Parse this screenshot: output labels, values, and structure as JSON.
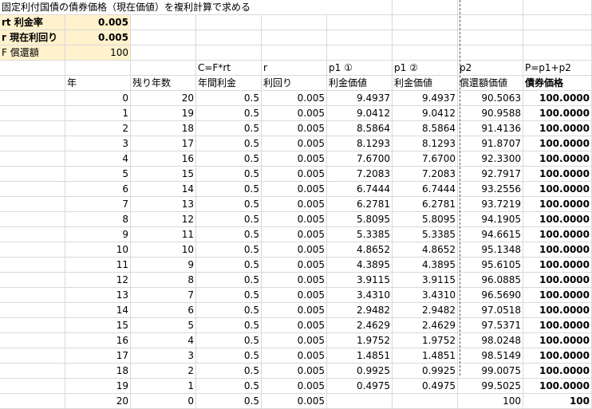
{
  "sheet": {
    "title": "固定利付国債の債券価格（現在価値）を複利計算で求める",
    "params": [
      {
        "label": "rt 利金率",
        "value": "0.005",
        "bold": true
      },
      {
        "label": "r 現在利回り",
        "value": "0.005",
        "bold": true
      },
      {
        "label": "F 償還額",
        "value": "100",
        "bold": false
      }
    ],
    "header_row1": [
      "",
      "",
      "",
      "C=F*rt",
      "r",
      "p1 ①",
      "p1 ②",
      "p2",
      "P=p1+p2"
    ],
    "header_row2": [
      "",
      "年",
      "残り年数",
      "年間利金",
      "利回り",
      "利金価値",
      "利金価値",
      "償還額価値",
      "債券価格"
    ],
    "rows": [
      [
        "0",
        "20",
        "0.5",
        "0.005",
        "9.4937",
        "9.4937",
        "90.5063",
        "100.0000"
      ],
      [
        "1",
        "19",
        "0.5",
        "0.005",
        "9.0412",
        "9.0412",
        "90.9588",
        "100.0000"
      ],
      [
        "2",
        "18",
        "0.5",
        "0.005",
        "8.5864",
        "8.5864",
        "91.4136",
        "100.0000"
      ],
      [
        "3",
        "17",
        "0.5",
        "0.005",
        "8.1293",
        "8.1293",
        "91.8707",
        "100.0000"
      ],
      [
        "4",
        "16",
        "0.5",
        "0.005",
        "7.6700",
        "7.6700",
        "92.3300",
        "100.0000"
      ],
      [
        "5",
        "15",
        "0.5",
        "0.005",
        "7.2083",
        "7.2083",
        "92.7917",
        "100.0000"
      ],
      [
        "6",
        "14",
        "0.5",
        "0.005",
        "6.7444",
        "6.7444",
        "93.2556",
        "100.0000"
      ],
      [
        "7",
        "13",
        "0.5",
        "0.005",
        "6.2781",
        "6.2781",
        "93.7219",
        "100.0000"
      ],
      [
        "8",
        "12",
        "0.5",
        "0.005",
        "5.8095",
        "5.8095",
        "94.1905",
        "100.0000"
      ],
      [
        "9",
        "11",
        "0.5",
        "0.005",
        "5.3385",
        "5.3385",
        "94.6615",
        "100.0000"
      ],
      [
        "10",
        "10",
        "0.5",
        "0.005",
        "4.8652",
        "4.8652",
        "95.1348",
        "100.0000"
      ],
      [
        "11",
        "9",
        "0.5",
        "0.005",
        "4.3895",
        "4.3895",
        "95.6105",
        "100.0000"
      ],
      [
        "12",
        "8",
        "0.5",
        "0.005",
        "3.9115",
        "3.9115",
        "96.0885",
        "100.0000"
      ],
      [
        "13",
        "7",
        "0.5",
        "0.005",
        "3.4310",
        "3.4310",
        "96.5690",
        "100.0000"
      ],
      [
        "14",
        "6",
        "0.5",
        "0.005",
        "2.9482",
        "2.9482",
        "97.0518",
        "100.0000"
      ],
      [
        "15",
        "5",
        "0.5",
        "0.005",
        "2.4629",
        "2.4629",
        "97.5371",
        "100.0000"
      ],
      [
        "16",
        "4",
        "0.5",
        "0.005",
        "1.9752",
        "1.9752",
        "98.0248",
        "100.0000"
      ],
      [
        "17",
        "3",
        "0.5",
        "0.005",
        "1.4851",
        "1.4851",
        "98.5149",
        "100.0000"
      ],
      [
        "18",
        "2",
        "0.5",
        "0.005",
        "0.9925",
        "0.9925",
        "99.0075",
        "100.0000"
      ],
      [
        "19",
        "1",
        "0.5",
        "0.005",
        "0.4975",
        "0.4975",
        "99.5025",
        "100.0000"
      ],
      [
        "20",
        "0",
        "0.5",
        "0.005",
        "",
        "",
        "100",
        "100"
      ]
    ],
    "colors": {
      "param_fill": "#fff2cc",
      "gridline": "#d9d9d9",
      "page_break": "#555555"
    }
  }
}
